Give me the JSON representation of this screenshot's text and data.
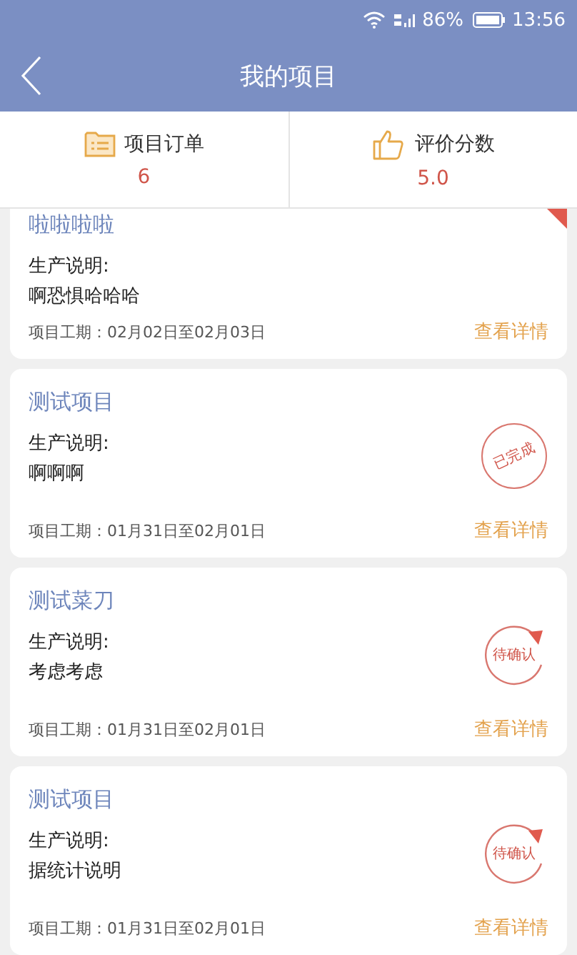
{
  "status_bar": {
    "battery_text": "86%",
    "time": "13:56"
  },
  "header": {
    "title": "我的项目"
  },
  "stats": [
    {
      "kind": "orders",
      "label": "项目订单",
      "value": "6"
    },
    {
      "kind": "rating",
      "label": "评价分数",
      "value": "5.0"
    }
  ],
  "projects": [
    {
      "title": "啦啦啦啦",
      "desc_label": "生产说明:",
      "desc": "啊恐惧哈哈哈",
      "period": "项目工期：02月02日至02月03日",
      "link": "查看详情",
      "stamp": {
        "kind": "corner"
      }
    },
    {
      "title": "测试项目",
      "desc_label": "生产说明:",
      "desc": "啊啊啊",
      "period": "项目工期：01月31日至02月01日",
      "link": "查看详情",
      "stamp": {
        "kind": "done",
        "text": "已完成"
      }
    },
    {
      "title": "测试菜刀",
      "desc_label": "生产说明:",
      "desc": "考虑考虑",
      "period": "项目工期：01月31日至02月01日",
      "link": "查看详情",
      "stamp": {
        "kind": "pending",
        "text": "待确认"
      }
    },
    {
      "title": "测试项目",
      "desc_label": "生产说明:",
      "desc": "据统计说明",
      "period": "项目工期：01月31日至02月01日",
      "link": "查看详情",
      "stamp": {
        "kind": "pending",
        "text": "待确认"
      }
    }
  ]
}
